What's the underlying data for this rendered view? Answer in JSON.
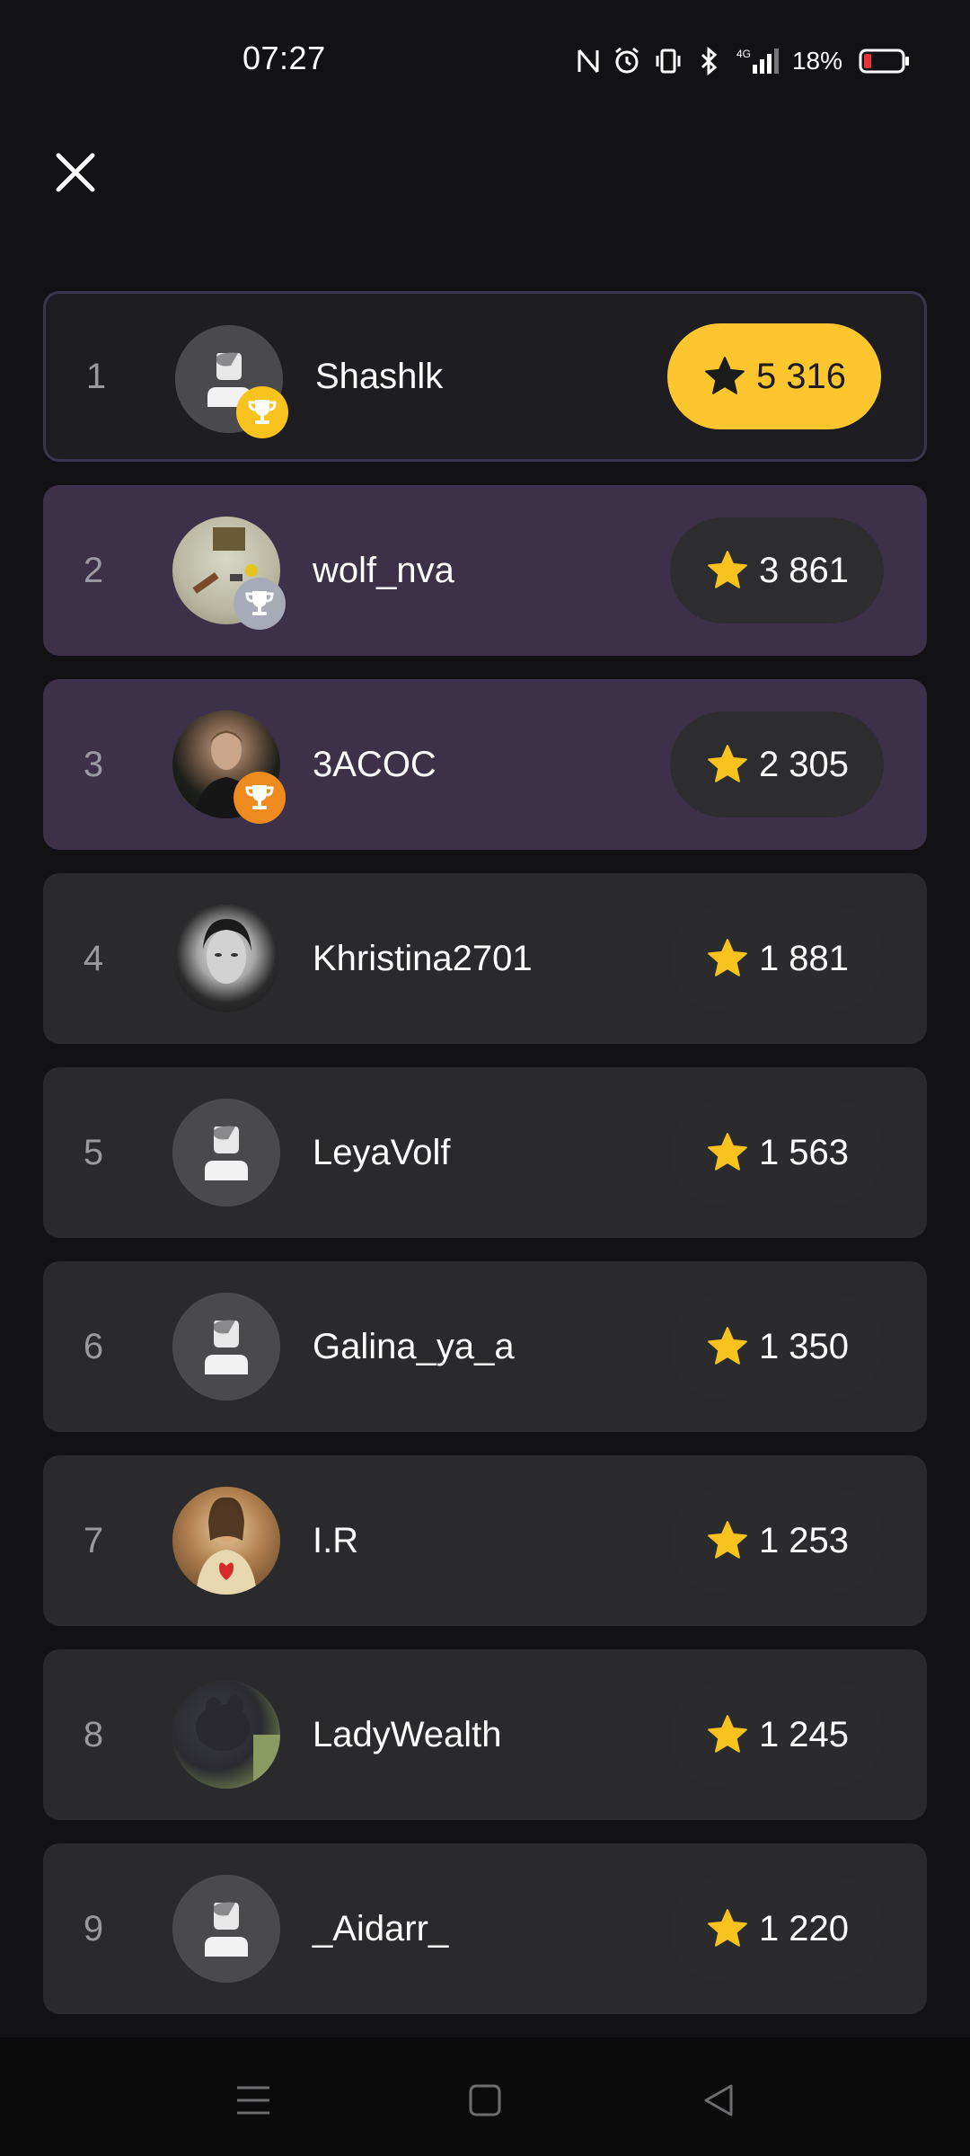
{
  "status_bar": {
    "time": "07:27",
    "battery": "18%",
    "icons": [
      "nfc-icon",
      "alarm-icon",
      "vibrate-icon",
      "bluetooth-icon",
      "signal-4g-icon",
      "battery-icon"
    ],
    "network": "4G"
  },
  "header": {
    "close_icon": "close-icon"
  },
  "colors": {
    "background": "#121214",
    "row": "#2a2a2c",
    "highlight_row": "#3c3148",
    "gold": "#fdc62e",
    "silver": "#a7abb8",
    "bronze": "#ef8a1e",
    "star": "#f7c31c"
  },
  "leaderboard": [
    {
      "rank": "1",
      "name": "Shashlk",
      "score": "5 316",
      "trophy": "gold",
      "avatar": "default-avatar"
    },
    {
      "rank": "2",
      "name": "wolf_nva",
      "score": "3 861",
      "trophy": "silver",
      "avatar": "photo-avatar"
    },
    {
      "rank": "3",
      "name": "3ACOC",
      "score": "2 305",
      "trophy": "bronze",
      "avatar": "photo-avatar"
    },
    {
      "rank": "4",
      "name": "Khristina2701",
      "score": "1 881",
      "avatar": "photo-avatar"
    },
    {
      "rank": "5",
      "name": "LeyaVolf",
      "score": "1 563",
      "avatar": "default-avatar"
    },
    {
      "rank": "6",
      "name": "Galina_ya_a",
      "score": "1 350",
      "avatar": "default-avatar"
    },
    {
      "rank": "7",
      "name": "I.R",
      "score": "1 253",
      "avatar": "photo-avatar"
    },
    {
      "rank": "8",
      "name": "LadyWealth",
      "score": "1 245",
      "avatar": "photo-avatar"
    },
    {
      "rank": "9",
      "name": "_Aidarr_",
      "score": "1 220",
      "avatar": "default-avatar"
    }
  ],
  "nav_bar": {
    "items": [
      "menu-icon",
      "home-icon",
      "back-icon"
    ]
  }
}
